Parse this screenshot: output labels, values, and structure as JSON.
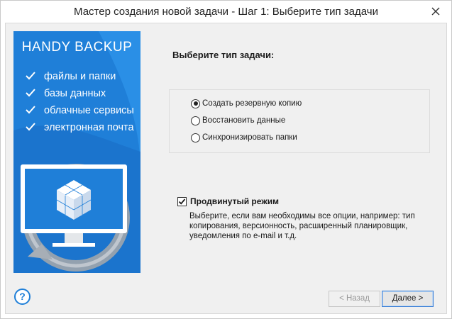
{
  "window": {
    "title": "Мастер создания новой задачи - Шаг 1: Выберите тип задачи"
  },
  "banner": {
    "brand": "HANDY BACKUP",
    "features": [
      "файлы и папки",
      "базы данных",
      "облачные сервисы",
      "электронная почта"
    ],
    "colors": {
      "background": "#1f7fd8",
      "accent": "#ffffff"
    }
  },
  "main": {
    "heading": "Выберите тип задачи:",
    "task_options": [
      {
        "label": "Создать резервную копию",
        "selected": true
      },
      {
        "label": "Восстановить данные",
        "selected": false
      },
      {
        "label": "Синхронизировать папки",
        "selected": false
      }
    ],
    "advanced": {
      "label": "Продвинутый режим",
      "checked": true,
      "description": "Выберите, если вам необходимы все опции, например: тип копирования, версионность, расширенный планировщик, уведомления по e-mail и т.д."
    }
  },
  "footer": {
    "help_label": "?",
    "back_label": "< Назад",
    "next_label": "Далее >"
  }
}
